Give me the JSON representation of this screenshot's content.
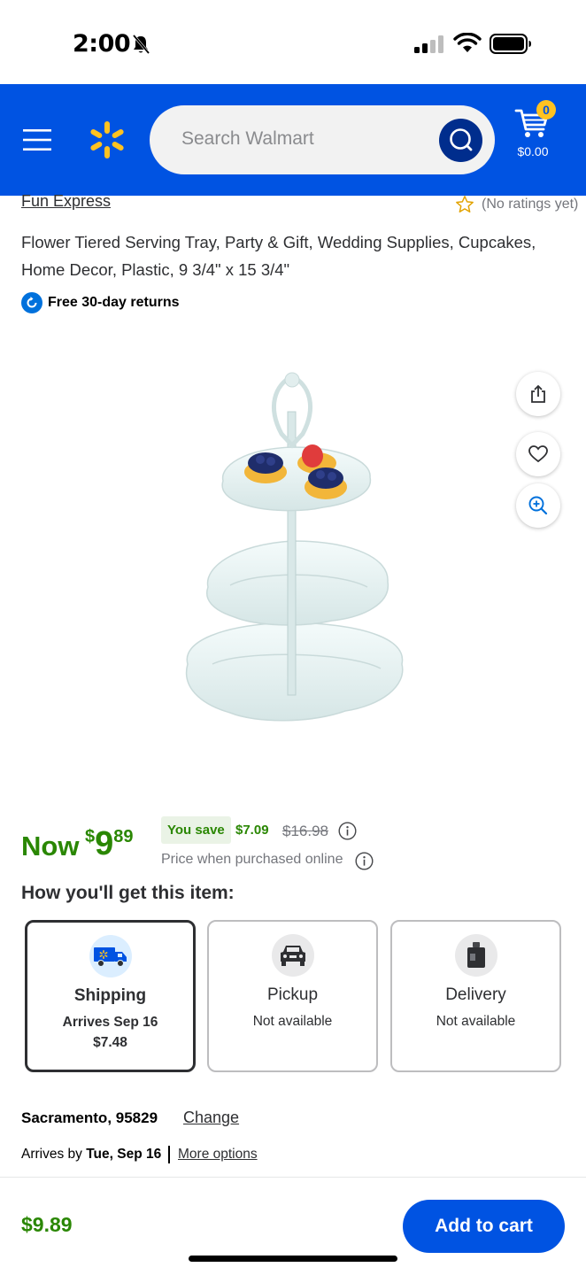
{
  "status_bar": {
    "time": "2:00"
  },
  "header": {
    "search_placeholder": "Search Walmart",
    "cart_count": "0",
    "cart_total": "$0.00",
    "brand_color": "#0053e2",
    "spark_color": "#ffc220"
  },
  "product": {
    "brand": "Fun Express",
    "rating_text": "(No ratings yet)",
    "title": "Flower Tiered Serving Tray, Party & Gift, Wedding Supplies, Cupcakes, Home Decor, Plastic, 9 3/4\" x 15 3/4\"",
    "returns": "Free 30-day returns"
  },
  "price": {
    "now_label": "Now",
    "currency": "$",
    "dollars": "9",
    "cents": "89",
    "you_save_label": "You save",
    "save_amount": "$7.09",
    "was_price": "$16.98",
    "note": "Price when purchased online",
    "accent_color": "#2a8703"
  },
  "fulfillment": {
    "heading": "How you'll get this item:",
    "options": [
      {
        "title": "Shipping",
        "line1": "Arrives Sep 16",
        "line2": "$7.48",
        "icon": "shipping-truck-icon"
      },
      {
        "title": "Pickup",
        "line1": "Not available",
        "icon": "pickup-car-icon"
      },
      {
        "title": "Delivery",
        "line1": "Not available",
        "icon": "delivery-bag-icon"
      }
    ]
  },
  "location": {
    "city": "Sacramento, 95829",
    "change_label": "Change",
    "arrives_prefix": "Arrives by",
    "arrives_date": "Tue, Sep 16",
    "more_options": "More options"
  },
  "bottom_bar": {
    "price": "$9.89",
    "add_to_cart": "Add to cart"
  }
}
